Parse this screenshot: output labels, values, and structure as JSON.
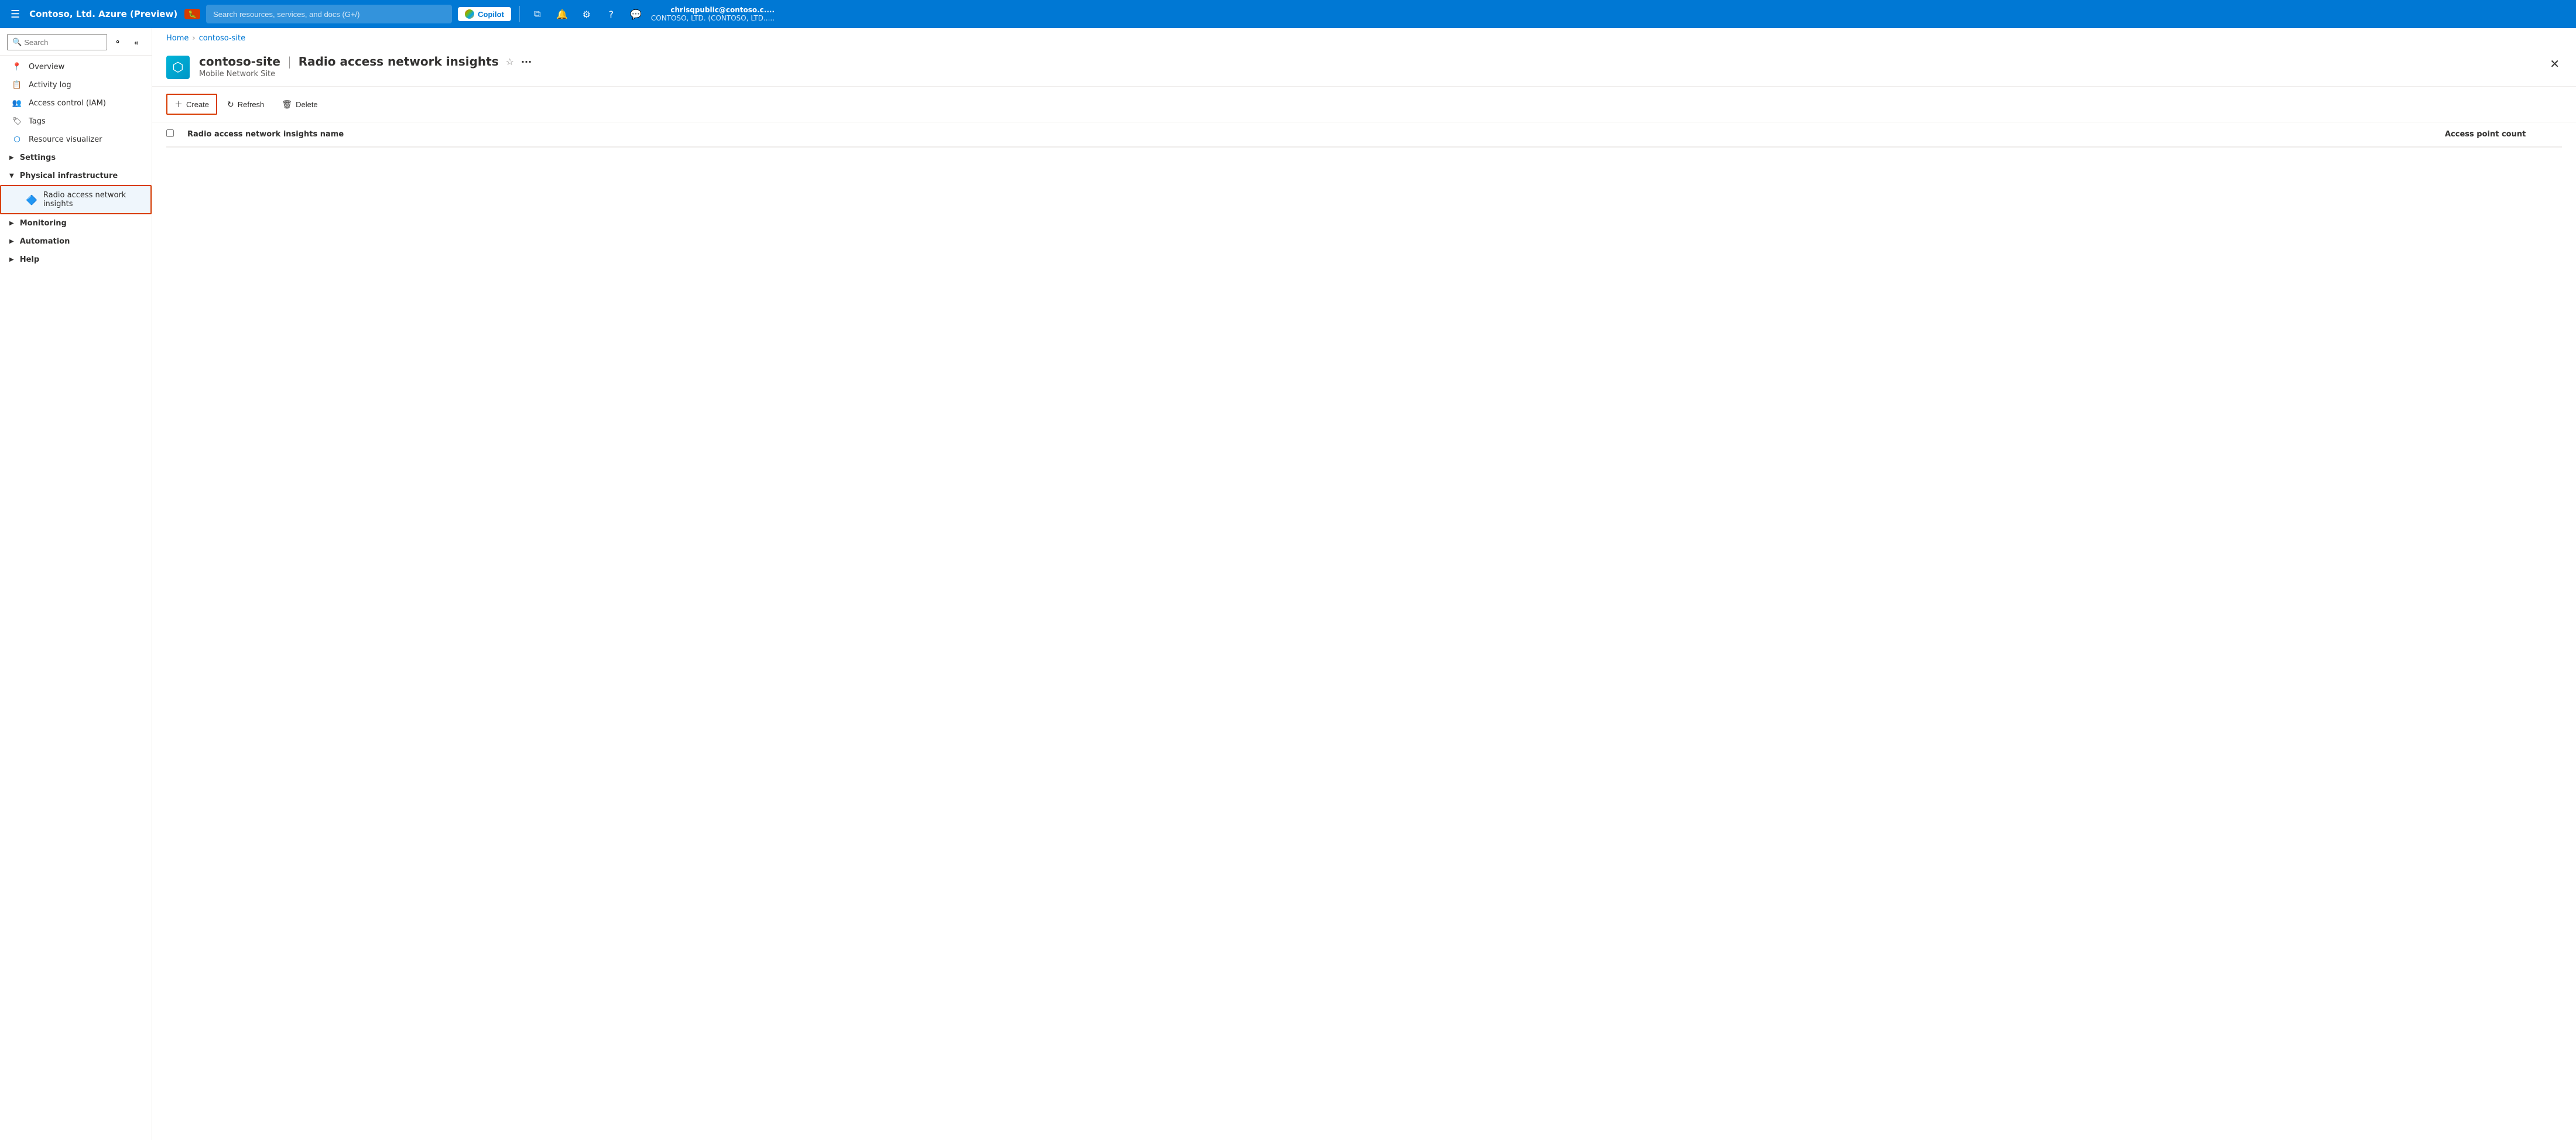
{
  "topnav": {
    "hamburger_label": "☰",
    "title": "Contoso, Ltd. Azure (Preview)",
    "bug_label": "🐛",
    "search_placeholder": "Search resources, services, and docs (G+/)",
    "copilot_label": "Copilot",
    "icons": {
      "portal": "⧉",
      "bell": "🔔",
      "gear": "⚙",
      "help": "?",
      "feedback": "💬"
    },
    "user": {
      "name": "chrisqpublic@contoso.c....",
      "org": "CONTOSO, LTD. (CONTOSO, LTD....."
    }
  },
  "breadcrumb": {
    "home": "Home",
    "site": "contoso-site"
  },
  "page_header": {
    "resource_name": "contoso-site",
    "separator": "|",
    "page_name": "Radio access network insights",
    "subtitle": "Mobile Network Site"
  },
  "toolbar": {
    "create_label": "Create",
    "refresh_label": "Refresh",
    "delete_label": "Delete"
  },
  "sidebar": {
    "search_placeholder": "Search",
    "items": [
      {
        "id": "overview",
        "label": "Overview",
        "icon": "📍"
      },
      {
        "id": "activity-log",
        "label": "Activity log",
        "icon": "📋"
      },
      {
        "id": "access-control",
        "label": "Access control (IAM)",
        "icon": "👥"
      },
      {
        "id": "tags",
        "label": "Tags",
        "icon": "🏷"
      },
      {
        "id": "resource-visualizer",
        "label": "Resource visualizer",
        "icon": "🔗"
      },
      {
        "id": "settings",
        "label": "Settings",
        "icon": "",
        "expandable": true,
        "expanded": false
      },
      {
        "id": "physical-infrastructure",
        "label": "Physical infrastructure",
        "icon": "",
        "expandable": true,
        "expanded": true
      },
      {
        "id": "radio-access-network-insights",
        "label": "Radio access network insights",
        "icon": "🔷",
        "sub": true,
        "active": true
      },
      {
        "id": "monitoring",
        "label": "Monitoring",
        "icon": "",
        "expandable": true,
        "expanded": false
      },
      {
        "id": "automation",
        "label": "Automation",
        "icon": "",
        "expandable": true,
        "expanded": false
      },
      {
        "id": "help",
        "label": "Help",
        "icon": "",
        "expandable": true,
        "expanded": false
      }
    ]
  },
  "table": {
    "col_name": "Radio access network insights name",
    "col_count": "Access point count",
    "rows": []
  }
}
